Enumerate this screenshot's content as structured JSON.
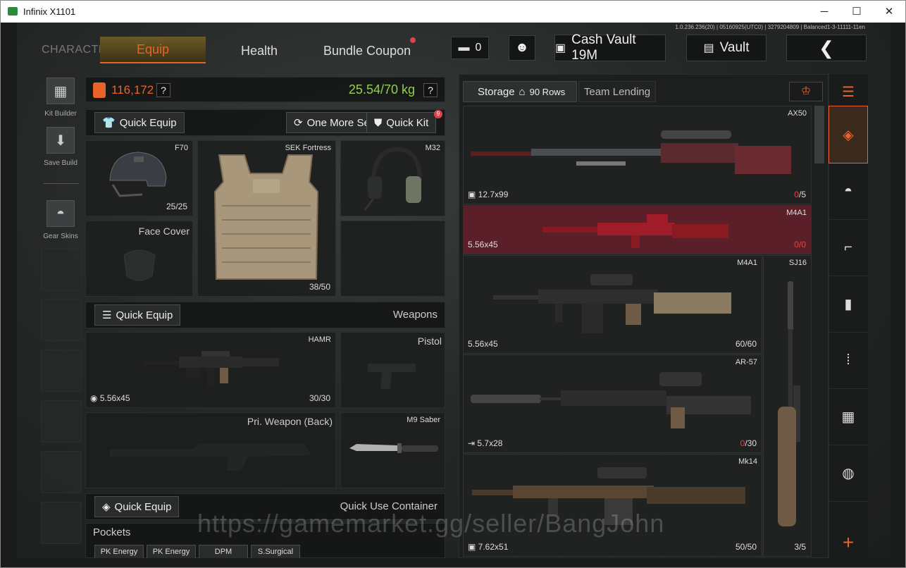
{
  "window": {
    "title": "Infinix X1101",
    "controls": [
      "─",
      "☐",
      "✕"
    ]
  },
  "version": "1.0.236.236(20) | 05160925(UTC0) | 3279204809 | Balanced1-3-11111-11en",
  "nav": {
    "character": "CHARACTER",
    "tabs": [
      "Equip",
      "Health",
      "Bundle Coupon"
    ],
    "active": "Equip"
  },
  "topbar": {
    "currency_count": "0",
    "cash_vault": "Cash Vault 19M",
    "vault": "Vault"
  },
  "left_sidebar": {
    "kit_builder": "Kit Builder",
    "save_build": "Save Build",
    "gear_skins": "Gear Skins"
  },
  "loadout": {
    "value": "116,172",
    "weight": "25.54/70 kg",
    "help": "?",
    "quick_equip": "Quick Equip",
    "one_more_set": "One More Set",
    "quick_kit": "Quick Kit",
    "quick_kit_badge": "9",
    "helmet": {
      "name": "F70",
      "durability": "25/25"
    },
    "armor": {
      "name": "SEK Fortress",
      "durability": "38/50"
    },
    "headset": {
      "name": "M32"
    },
    "face_cover": {
      "name": "Face Cover"
    }
  },
  "weapons": {
    "quick_equip": "Quick Equip",
    "title": "Weapons",
    "primary": {
      "name": "HAMR",
      "ammo": "5.56x45",
      "count": "30/30"
    },
    "pistol": {
      "name": "Pistol"
    },
    "secondary": {
      "name": "Pri. Weapon (Back)"
    },
    "melee": {
      "name": "M9 Saber"
    }
  },
  "container": {
    "quick_equip": "Quick Equip",
    "title": "Quick Use Container"
  },
  "pockets": {
    "title": "Pockets",
    "items": [
      "PK Energy",
      "PK Energy",
      "DPM",
      "S.Surgical"
    ]
  },
  "storage": {
    "tab": "Storage",
    "rows": "90 Rows",
    "team_lending": "Team Lending",
    "items": [
      {
        "name": "AX50",
        "ammo": "12.7x99",
        "count_cur": "0",
        "count_max": "/5"
      },
      {
        "name": "M4A1",
        "ammo": "5.56x45",
        "count_cur": "0",
        "count_max": "/0"
      },
      {
        "name": "M4A1",
        "ammo": "5.56x45",
        "count_cur": "60",
        "count_max": "/60"
      },
      {
        "name": "AR-57",
        "ammo": "5.7x28",
        "count_cur": "0",
        "count_max": "/30"
      },
      {
        "name": "Mk14",
        "ammo": "7.62x51",
        "count_cur": "50",
        "count_max": "/50"
      }
    ],
    "side_item": {
      "name": "SJ16",
      "count": "3/5"
    }
  },
  "watermark": "https://gamemarket.gg/seller/BangJohn",
  "colors": {
    "accent": "#e8632a",
    "weight_green": "#8fd14f",
    "warn_red": "#e0444a",
    "highlight_row": "#5a1f29"
  }
}
